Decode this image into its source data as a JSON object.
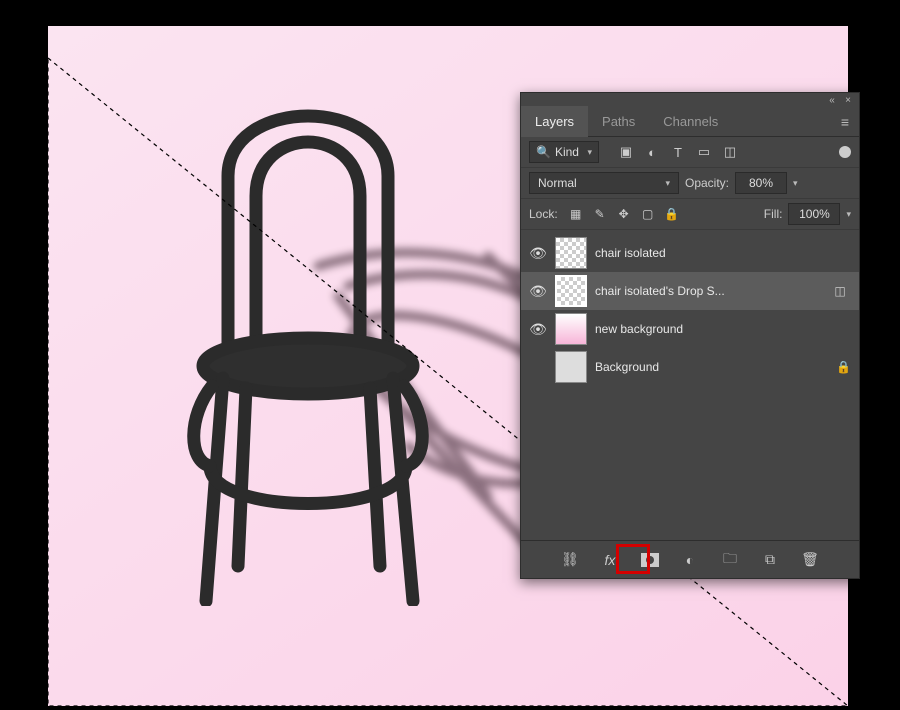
{
  "panel": {
    "tabs": {
      "layers": "Layers",
      "paths": "Paths",
      "channels": "Channels"
    },
    "filter_kind": "Kind",
    "blend_mode": "Normal",
    "opacity_label": "Opacity:",
    "opacity_value": "80%",
    "lock_label": "Lock:",
    "fill_label": "Fill:",
    "fill_value": "100%"
  },
  "layers": [
    {
      "name": "chair isolated",
      "visible": true,
      "thumb": "checker",
      "selected": false
    },
    {
      "name": "chair isolated's Drop S...",
      "visible": true,
      "thumb": "checker",
      "selected": true,
      "smart": true
    },
    {
      "name": "new background",
      "visible": true,
      "thumb": "pink",
      "selected": false
    },
    {
      "name": "Background",
      "visible": false,
      "thumb": "white",
      "selected": false,
      "locked": true
    }
  ],
  "filter_icons": {
    "image": "image-icon",
    "adjustment": "adjustment-icon",
    "type": "type-icon",
    "shape": "shape-icon",
    "smart": "smart-object-icon"
  },
  "lock_icons": {
    "transparency": "lock-transparency-icon",
    "brush": "lock-pixels-icon",
    "move": "lock-position-icon",
    "artboard": "lock-artboard-icon",
    "all": "lock-all-icon"
  },
  "footer_icons": {
    "link": "link-layers-icon",
    "fx": "layer-style-icon",
    "mask": "add-mask-icon",
    "adjust": "new-adjustment-icon",
    "group": "new-group-icon",
    "new": "new-layer-icon",
    "trash": "delete-layer-icon"
  }
}
